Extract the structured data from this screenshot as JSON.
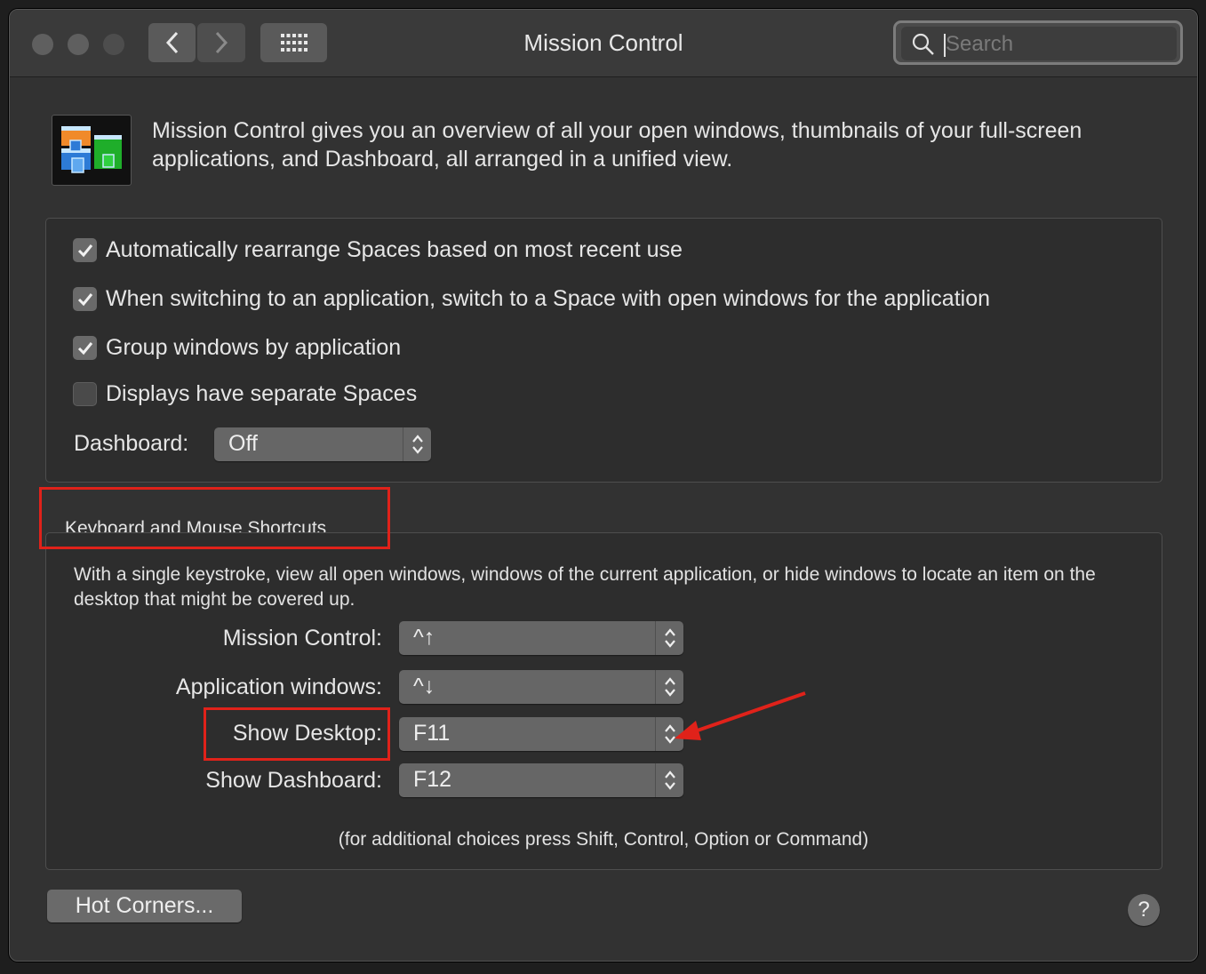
{
  "window": {
    "title": "Mission Control"
  },
  "search": {
    "placeholder": "Search",
    "value": ""
  },
  "header": {
    "description": "Mission Control gives you an overview of all your open windows, thumbnails of your full-screen applications, and Dashboard, all arranged in a unified view."
  },
  "options": [
    {
      "label": "Automatically rearrange Spaces based on most recent use",
      "checked": true
    },
    {
      "label": "When switching to an application, switch to a Space with open windows for the application",
      "checked": true
    },
    {
      "label": "Group windows by application",
      "checked": true
    },
    {
      "label": "Displays have separate Spaces",
      "checked": false
    }
  ],
  "dashboard": {
    "label": "Dashboard:",
    "value": "Off"
  },
  "shortcuts": {
    "title": "Keyboard and Mouse Shortcuts",
    "description": "With a single keystroke, view all open windows, windows of the current application, or hide windows to locate an item on the desktop that might be covered up.",
    "rows": [
      {
        "label": "Mission Control:",
        "value": "^↑"
      },
      {
        "label": "Application windows:",
        "value": "^↓"
      },
      {
        "label": "Show Desktop:",
        "value": "F11"
      },
      {
        "label": "Show Dashboard:",
        "value": "F12"
      }
    ],
    "hint": "(for additional choices press Shift, Control, Option or Command)"
  },
  "footer": {
    "hot_corners_label": "Hot Corners...",
    "help_label": "?"
  },
  "colors": {
    "annotation_red": "#e0221a",
    "window_bg": "#323232",
    "popup_bg": "#666666"
  }
}
